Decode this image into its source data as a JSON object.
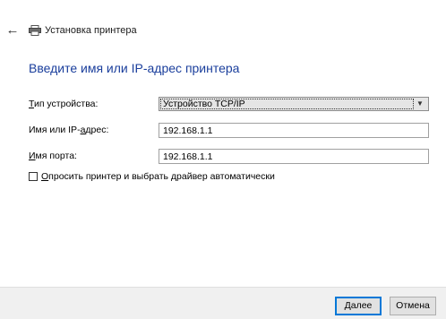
{
  "window": {
    "title": "Установка принтера",
    "back_icon": "arrow-left-icon",
    "printer_icon": "printer-icon"
  },
  "main": {
    "heading": "Введите имя или IP-адрес принтера",
    "device_type": {
      "label_hotkey": "Т",
      "label_rest": "ип устройства:",
      "value": "Устройство TCP/IP"
    },
    "host": {
      "label_pre": "Имя или IP-",
      "label_hotkey": "а",
      "label_rest": "дрес:",
      "value": "192.168.1.1"
    },
    "port": {
      "label_hotkey": "И",
      "label_rest": "мя порта:",
      "value": "192.168.1.1"
    },
    "auto_query": {
      "checked": false,
      "label_hotkey": "О",
      "label_rest": "просить принтер и выбрать драйвер автоматически"
    }
  },
  "footer": {
    "next_hotkey": "Д",
    "next_rest": "алее",
    "cancel_label": "Отмена"
  },
  "colors": {
    "heading": "#1a3e9c",
    "default_button_border": "#0078d7"
  }
}
